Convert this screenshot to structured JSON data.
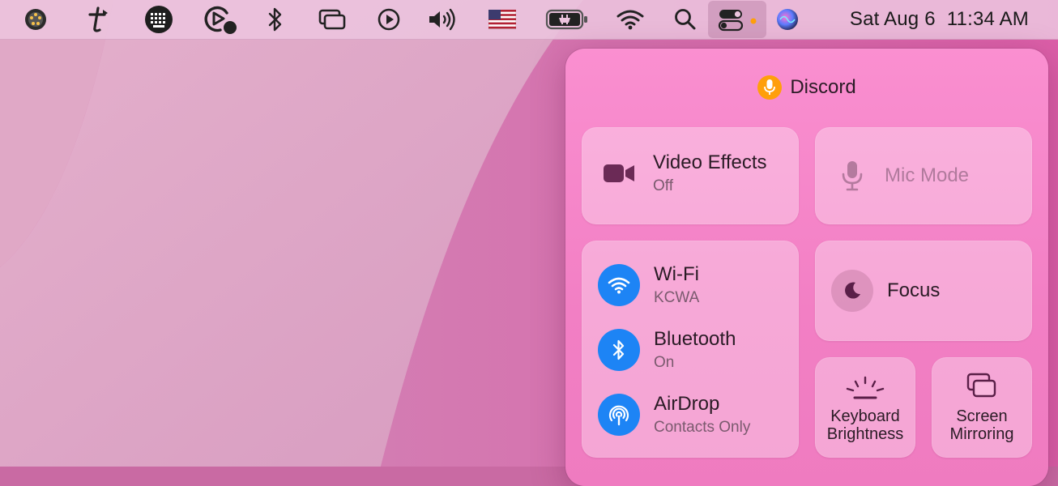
{
  "menubar": {
    "icons": [
      "app-dot-icon",
      "typora-icon",
      "keyboard-viewer-icon",
      "screen-recorder-icon",
      "bluetooth-icon",
      "screen-mirroring-icon",
      "play-icon",
      "volume-icon",
      "us-flag-icon",
      "battery-icon",
      "wifi-icon",
      "search-icon",
      "control-center-icon",
      "siri-icon"
    ],
    "clock": {
      "date": "Sat Aug 6",
      "time": "11:34 AM"
    }
  },
  "control_center": {
    "header": {
      "app": "Discord",
      "icon": "microphone-icon"
    },
    "video_effects": {
      "title": "Video Effects",
      "status": "Off"
    },
    "mic_mode": {
      "title": "Mic Mode"
    },
    "wifi": {
      "title": "Wi-Fi",
      "status": "KCWA"
    },
    "bluetooth": {
      "title": "Bluetooth",
      "status": "On"
    },
    "airdrop": {
      "title": "AirDrop",
      "status": "Contacts Only"
    },
    "focus": {
      "title": "Focus"
    },
    "keyboard_brightness": {
      "line1": "Keyboard",
      "line2": "Brightness"
    },
    "screen_mirroring": {
      "line1": "Screen",
      "line2": "Mirroring"
    }
  },
  "colors": {
    "accent_blue": "#1d84f5",
    "mic_orange": "#ff9f0a",
    "panel_pink": "#f27fc4"
  }
}
